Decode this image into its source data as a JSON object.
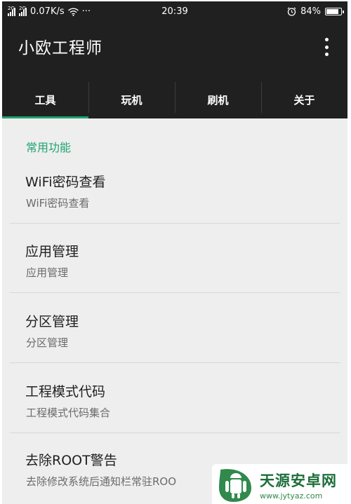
{
  "status_bar": {
    "signal_label": "2G",
    "network_speed": "0.07K/s",
    "more": "···",
    "time": "20:39",
    "battery_percent": "84%",
    "battery_level": 0.84
  },
  "app_bar": {
    "title": "小欧工程师",
    "overflow_icon": "more-vert-icon"
  },
  "tabs": [
    {
      "label": "工具",
      "active": true
    },
    {
      "label": "玩机",
      "active": false
    },
    {
      "label": "刷机",
      "active": false
    },
    {
      "label": "关于",
      "active": false
    }
  ],
  "section": {
    "header": "常用功能"
  },
  "items": [
    {
      "title": "WiFi密码查看",
      "subtitle": "WiFi密码查看"
    },
    {
      "title": "应用管理",
      "subtitle": "应用管理"
    },
    {
      "title": "分区管理",
      "subtitle": "分区管理"
    },
    {
      "title": "工程模式代码",
      "subtitle": "工程模式代码集合"
    },
    {
      "title": "去除ROOT警告",
      "subtitle": "去除修改系统后通知栏常驻ROO",
      "checked": true
    }
  ],
  "watermark": {
    "name": "天源安卓网",
    "url": "www.jytyaz.com"
  },
  "colors": {
    "accent": "#1fa370",
    "app_bar": "#202020",
    "background": "#eeeeee"
  }
}
